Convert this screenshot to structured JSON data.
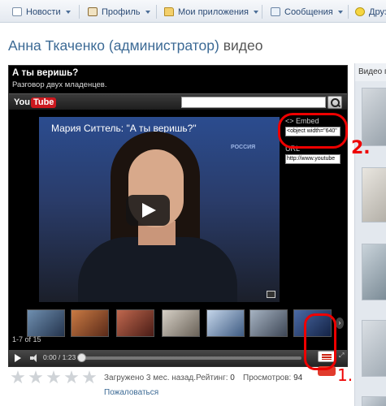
{
  "topnav": {
    "items": [
      {
        "label": "Новости",
        "icon": "news-icon"
      },
      {
        "label": "Профиль",
        "icon": "profile-icon"
      },
      {
        "label": "Мои приложения",
        "icon": "folder-icon"
      },
      {
        "label": "Сообщения",
        "icon": "mail-icon"
      },
      {
        "label": "Друз",
        "icon": "smile-icon"
      }
    ]
  },
  "page": {
    "title_name": "Анна Ткаченко (администратор)",
    "title_suffix": "видео"
  },
  "right_column": {
    "heading": "Видео п"
  },
  "video": {
    "title": "А ты веришь?",
    "subtitle": "Разговор двух младенцев.",
    "youtube_logo_you": "You",
    "youtube_logo_tube": "Tube",
    "caption": "Мария Ситтель: \"А ты веришь?\"",
    "channel_logo": "РОССИЯ",
    "embed_label": "<> Embed",
    "embed_value": "<object width=\"640\"",
    "url_label": "URL",
    "url_value": "http://www.youtube",
    "related_count": "1-7 of 15",
    "time": "0:00 / 1:23",
    "next_glyph": "›",
    "fullscreen_glyph": "⤢"
  },
  "annotations": {
    "marker1": "1.",
    "marker2": "2.",
    "color": "#e00000"
  },
  "rating": {
    "stars_total": 5,
    "stars_filled": 0,
    "star_glyph": "★"
  },
  "meta": {
    "uploaded": "Загружено 3 мес. назад.",
    "rating_label": "Рейтинг: ",
    "rating_value": "0",
    "views_label": "Просмотров: ",
    "views_value": "94",
    "complain": "Пожаловаться"
  },
  "colors": {
    "link": "#3c6a95",
    "youtube_red": "#cc181e"
  }
}
